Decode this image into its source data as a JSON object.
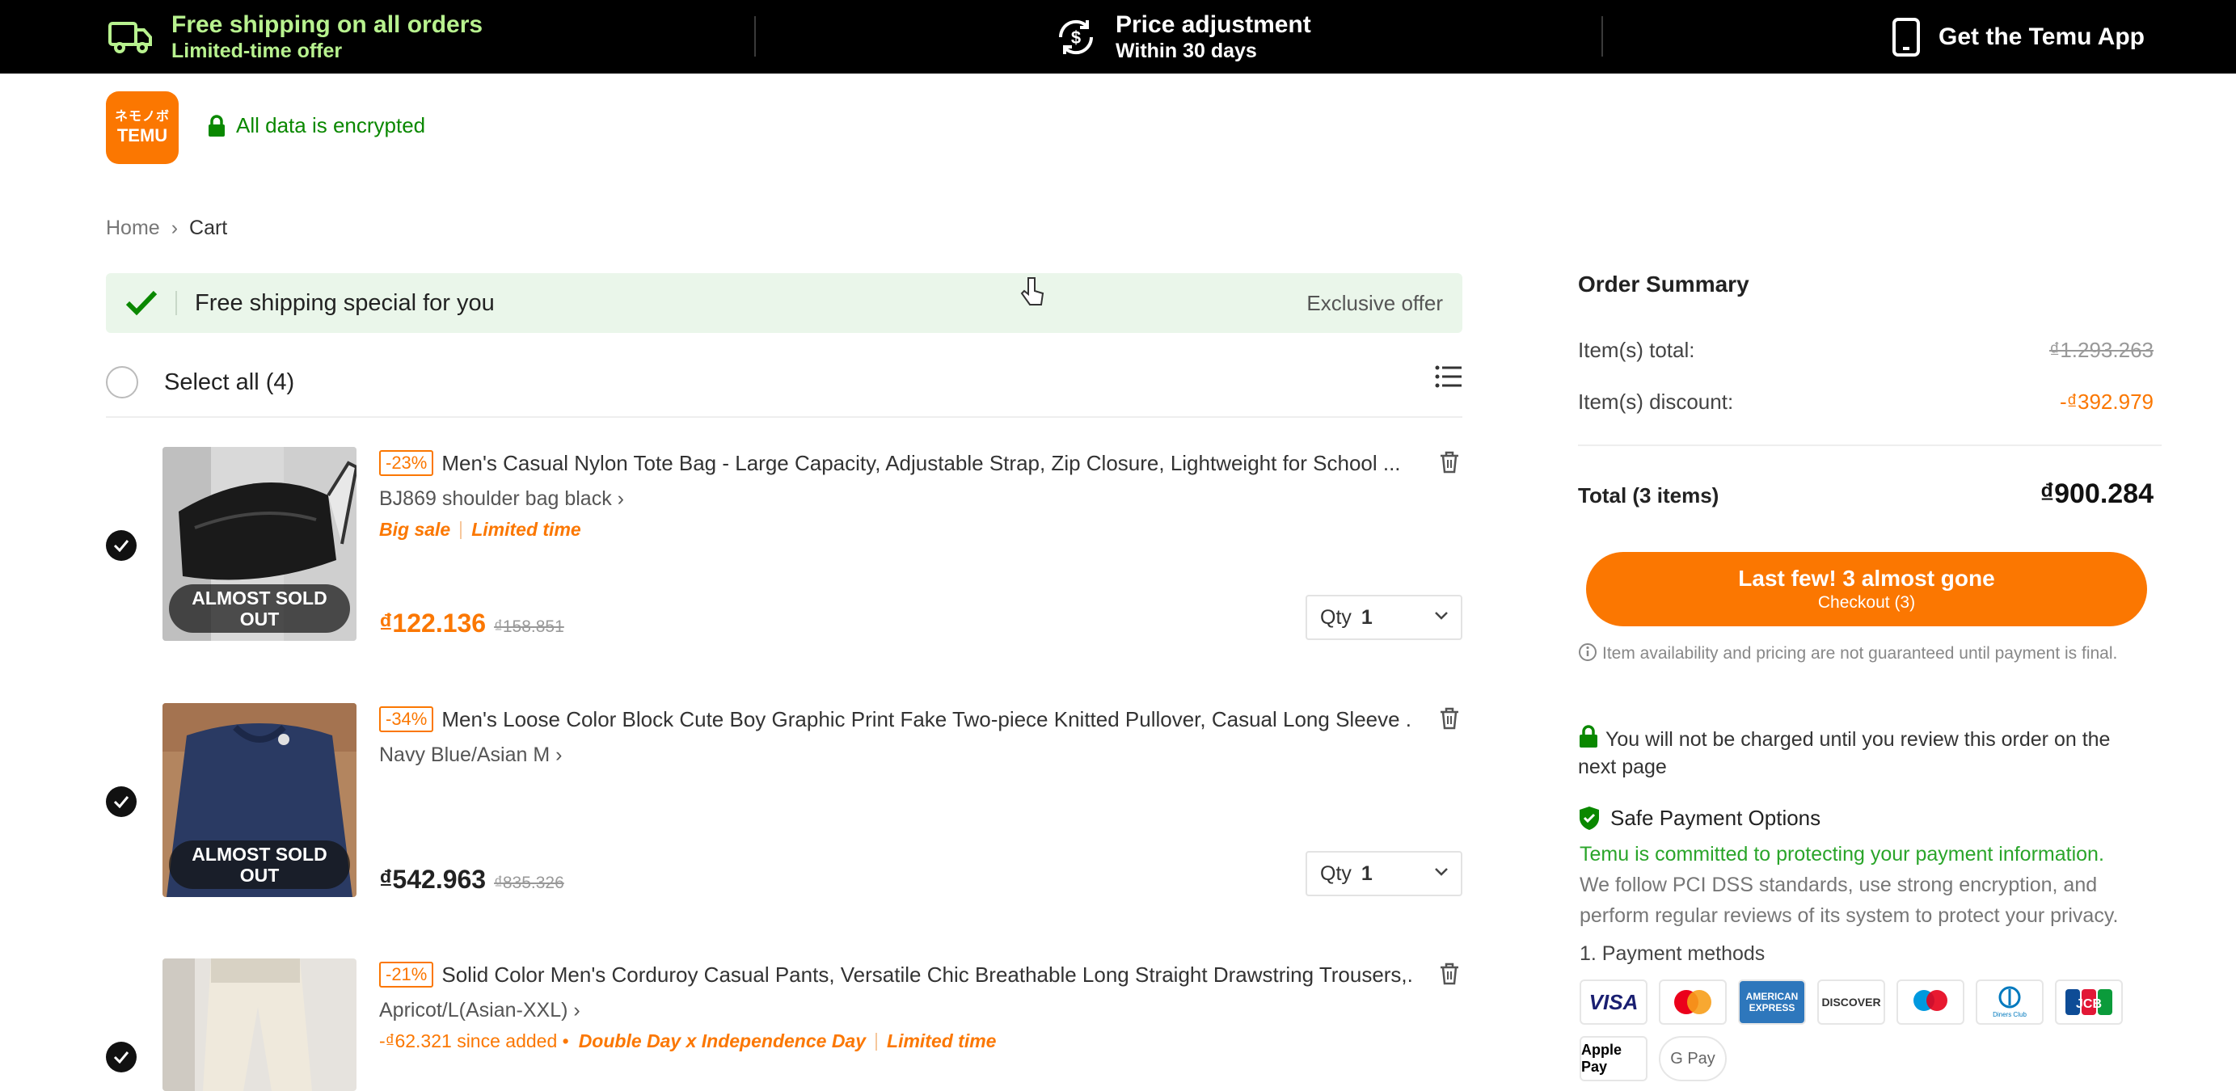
{
  "topbar": {
    "shipping": {
      "title": "Free shipping on all orders",
      "subtitle": "Limited-time offer"
    },
    "price": {
      "title": "Price adjustment",
      "subtitle": "Within 30 days"
    },
    "app": {
      "title": "Get the Temu App"
    }
  },
  "header": {
    "logo_top": "ネモノボ",
    "logo_bottom": "TEMU",
    "encrypted": "All data is encrypted"
  },
  "breadcrumb": {
    "home": "Home",
    "sep": "›",
    "current": "Cart"
  },
  "banner": {
    "text": "Free shipping special for you",
    "exclusive": "Exclusive offer"
  },
  "select_all": "Select all (4)",
  "items": [
    {
      "discount": "-23%",
      "title": "Men's Casual Nylon Tote Bag - Large Capacity, Adjustable Strap, Zip Closure, Lightweight for School ...",
      "variant": "BJ869 shoulder bag black ›",
      "tag1": "Big sale",
      "tag2": "Limited time",
      "badge": "ALMOST SOLD OUT",
      "price": "₫122.136",
      "original": "₫158.851",
      "qty_label": "Qty",
      "qty": "1"
    },
    {
      "discount": "-34%",
      "title": "Men's Loose Color Block Cute Boy Graphic Print Fake Two-piece Knitted Pullover, Casual Long Sleeve ...",
      "variant": "Navy Blue/Asian M ›",
      "badge": "ALMOST SOLD OUT",
      "price": "₫542.963",
      "original": "₫835.326",
      "qty_label": "Qty",
      "qty": "1"
    },
    {
      "discount": "-21%",
      "title": "Solid Color Men's Corduroy Casual Pants, Versatile Chic Breathable Long Straight Drawstring Trousers,...",
      "variant": "Apricot/L(Asian-XXL) ›",
      "since_added": "-₫62.321 since added •",
      "tag1": "Double Day x Independence Day",
      "tag2": "Limited time"
    }
  ],
  "summary": {
    "title": "Order Summary",
    "items_total_label": "Item(s) total:",
    "items_total": "₫1.293.263",
    "discount_label": "Item(s) discount:",
    "discount": "-₫392.979",
    "total_label": "Total (3 items)",
    "total": "₫900.284",
    "checkout_main": "Last few! 3 almost gone",
    "checkout_sub": "Checkout (3)",
    "availability_note": "Item availability and pricing are not guaranteed until payment is final.",
    "not_charged": "You will not be charged until you review this order on the next page",
    "safe_payment": "Safe Payment Options",
    "commitment": "Temu is committed to protecting your payment information.",
    "pci": "We follow PCI DSS standards, use strong encryption, and perform regular reviews of its system to protect your privacy.",
    "payment_methods": "1. Payment methods",
    "cards": [
      "VISA",
      "Mastercard",
      "AMERICAN EXPRESS",
      "DISCOVER",
      "Maestro",
      "Diners Club",
      "JCB"
    ],
    "wallets": [
      "Apple Pay",
      "G Pay"
    ]
  },
  "colors": {
    "accent": "#fb7701",
    "green": "#0a8800",
    "topbar": "#000000",
    "banner": "#eaf6ea"
  }
}
